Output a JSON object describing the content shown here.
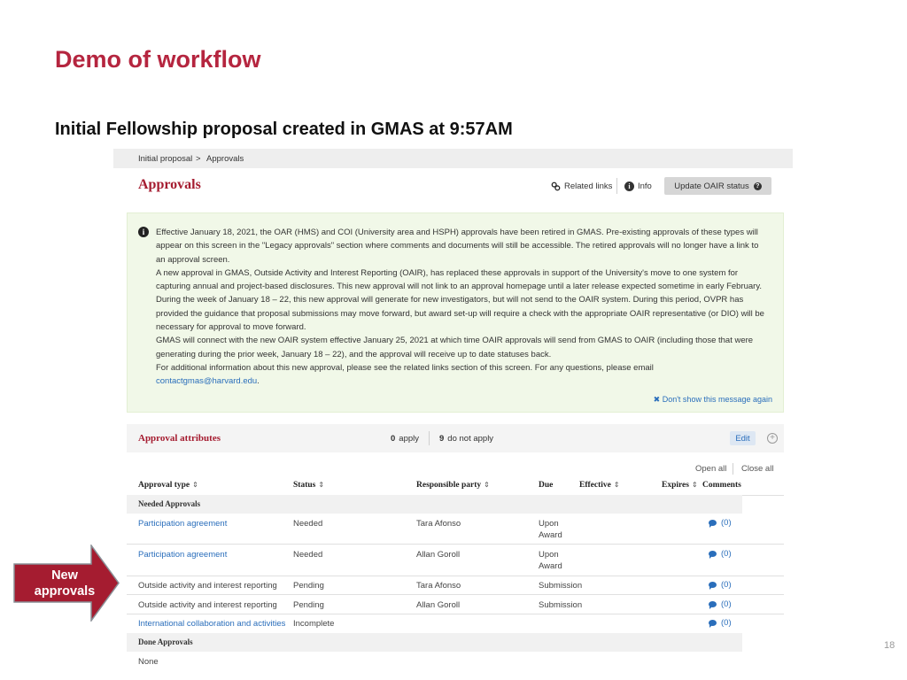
{
  "slide": {
    "title": "Demo of workflow",
    "subtitle": "Initial Fellowship proposal created in GMAS at 9:57AM",
    "page_number": "18",
    "arrow_label_line1": "New",
    "arrow_label_line2": "approvals"
  },
  "breadcrumb": {
    "item1": "Initial proposal",
    "separator": ">",
    "item2": "Approvals"
  },
  "header": {
    "title": "Approvals",
    "related_links": "Related links",
    "info": "Info",
    "update_button": "Update OAIR status"
  },
  "notice": {
    "paragraphs": [
      "Effective January 18, 2021, the OAR (HMS) and COI (University area and HSPH) approvals have been retired in GMAS. Pre-existing approvals of these types will appear on this screen in the \"Legacy approvals\" section where comments and documents will still be accessible. The retired approvals will no longer have a link to an approval screen.",
      "A new approval in GMAS, Outside Activity and Interest Reporting (OAIR), has replaced these approvals in support of the University's move to one system for capturing annual and project-based disclosures. This new approval will not link to an approval homepage until a later release expected sometime in early February.",
      "During the week of January 18 – 22, this new approval will generate for new investigators, but will not send to the OAIR system. During this period, OVPR has provided the guidance that proposal submissions may move forward, but award set-up will require a check with the appropriate OAIR representative (or DIO) will be necessary for approval to move forward.",
      "GMAS will connect with the new OAIR system effective January 25, 2021 at which time OAIR approvals will send from GMAS to OAIR (including those that were generating during the prior week, January 18 – 22), and the approval will receive up to date statuses back.",
      "For additional information about this new approval, please see the related links section of this screen. For any questions, please email"
    ],
    "email": "contactgmas@harvard.edu",
    "email_suffix": ".",
    "dismiss": "Don't show this message again"
  },
  "attributes": {
    "title": "Approval attributes",
    "apply_count": "0",
    "apply_label": "apply",
    "not_apply_count": "9",
    "not_apply_label": "do not apply",
    "edit": "Edit"
  },
  "table": {
    "open_all": "Open all",
    "close_all": "Close all",
    "headers": {
      "type": "Approval type",
      "status": "Status",
      "party": "Responsible party",
      "due": "Due",
      "effective": "Effective",
      "expires": "Expires",
      "comments": "Comments"
    },
    "sort_glyph": "⇕",
    "needed_group": "Needed Approvals",
    "rows": [
      {
        "type": "Participation agreement",
        "status": "Needed",
        "party": "Tara Afonso",
        "due1": "Upon",
        "due2": "Award",
        "comments": "(0)"
      },
      {
        "type": "Participation agreement",
        "status": "Needed",
        "party": "Allan Goroll",
        "due1": "Upon",
        "due2": "Award",
        "comments": "(0)"
      },
      {
        "type": "Outside activity and interest reporting",
        "status": "Pending",
        "party": "Tara Afonso",
        "due1": "Submission",
        "due2": "",
        "comments": "(0)"
      },
      {
        "type": "Outside activity and interest reporting",
        "status": "Pending",
        "party": "Allan Goroll",
        "due1": "Submission",
        "due2": "",
        "comments": "(0)"
      },
      {
        "type": "International collaboration and activities",
        "status": "Incomplete",
        "party": "",
        "due1": "",
        "due2": "",
        "comments": "(0)"
      }
    ],
    "done_group": "Done Approvals",
    "done_none": "None"
  },
  "colors": {
    "brand": "#b5253f",
    "link": "#2a6ebb",
    "notice_bg": "#f1f8e8",
    "arrow": "#a51c30"
  }
}
